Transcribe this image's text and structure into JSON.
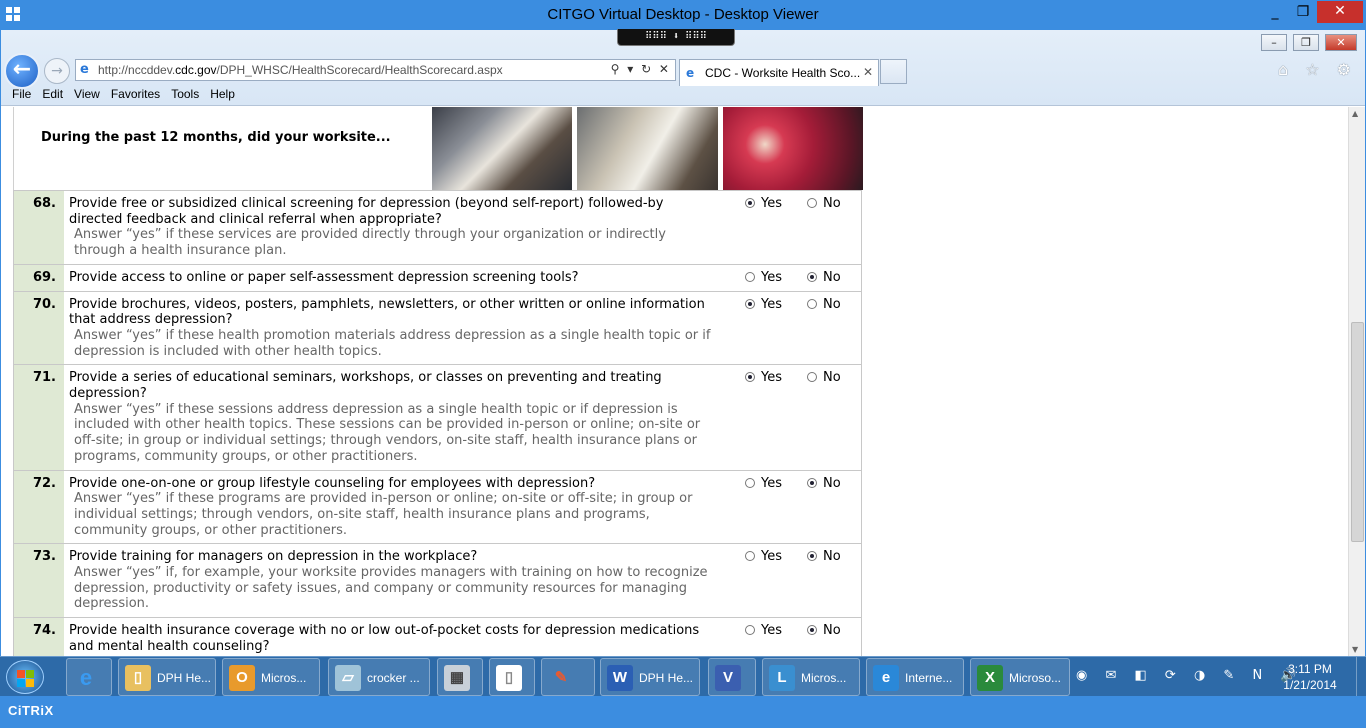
{
  "window": {
    "title": "CITGO Virtual Desktop - Desktop Viewer",
    "minimize": "_",
    "restore": "❐",
    "close": "✕"
  },
  "citrix_toolbar": {
    "label": "⠿⠿⠿ ⬇ ⠿⠿⠿"
  },
  "browser": {
    "url_host_prefix": "http://nccddev.",
    "url_host_main": "cdc.gov",
    "url_path": "/DPH_WHSC/HealthScorecard/HealthScorecard.aspx",
    "address_actions": "⚲ ▾ ↻ ✕",
    "tab_title": "CDC - Worksite Health Sco...",
    "tab_close": "✕",
    "toolbar_icons": "⌂ ☆ ⚙",
    "menu": [
      "File",
      "Edit",
      "View",
      "Favorites",
      "Tools",
      "Help"
    ]
  },
  "page": {
    "header_question": "During the past 12 months, did your worksite...",
    "yes_label": "Yes",
    "no_label": "No",
    "questions": [
      {
        "num": "68.",
        "text": "Provide free or subsidized clinical screening for depression (beyond self-report) followed-by directed feedback and clinical referral when appropriate?",
        "note": "Answer “yes” if these services are provided directly through your organization or indirectly through a health insurance plan.",
        "answer": "yes"
      },
      {
        "num": "69.",
        "text": "Provide access to online or paper self-assessment depression screening tools?",
        "note": "",
        "answer": "no"
      },
      {
        "num": "70.",
        "text": "Provide brochures, videos, posters, pamphlets, newsletters, or other written or online information that address depression?",
        "note": "Answer “yes” if these health promotion materials address depression as a single health topic or if depression is included with other health topics.",
        "answer": "yes"
      },
      {
        "num": "71.",
        "text": "Provide a series of educational seminars, workshops, or classes on preventing and treating depression?",
        "note": "Answer “yes” if these sessions address depression as a single health topic or if depression is included with other health topics. These sessions can be provided in-person or online; on-site or off-site; in group or individual settings; through vendors, on-site staff, health insurance plans or programs, community groups, or other practitioners.",
        "answer": "yes"
      },
      {
        "num": "72.",
        "text": "Provide one-on-one or group lifestyle counseling for employees with depression?",
        "note": "Answer “yes” if these programs are provided in-person or online; on-site or off-site; in group or individual settings; through vendors, on-site staff, health insurance plans and programs, community groups, or other practitioners.",
        "answer": "no"
      },
      {
        "num": "73.",
        "text": "Provide training for managers on depression in the workplace?",
        "note": "Answer “yes” if, for example, your worksite provides managers with training on how to recognize depression, productivity or safety issues, and company or community resources for managing depression.",
        "answer": "no"
      },
      {
        "num": "74.",
        "text": "Provide health insurance coverage with no or low out-of-pocket costs for depression medications and mental health counseling?",
        "note": "",
        "answer": "no"
      }
    ]
  },
  "taskbar": {
    "items": [
      {
        "label": "DPH He...",
        "icon": "folder-icon",
        "glyph": "▯",
        "color": "#e8c060"
      },
      {
        "label": "Micros...",
        "icon": "outlook-icon",
        "glyph": "O",
        "color": "#e89a2c"
      },
      {
        "label": "crocker ...",
        "icon": "notepad-icon",
        "glyph": "▱",
        "color": "#9fc3d8"
      },
      {
        "label": "DPH He...",
        "icon": "word-icon",
        "glyph": "W",
        "color": "#2b5fb4"
      },
      {
        "label": "Micros...",
        "icon": "lync-icon",
        "glyph": "L",
        "color": "#3a8fd0"
      },
      {
        "label": "Interne...",
        "icon": "ie-icon",
        "glyph": "e",
        "color": "#2a88d8"
      },
      {
        "label": "Microso...",
        "icon": "excel-icon",
        "glyph": "X",
        "color": "#2a8a3c"
      }
    ],
    "tray_icons": "◉ ✉ ◧ ⟳ ◑ ✎ N 🔊",
    "time": "3:11 PM",
    "date": "1/21/2014"
  },
  "status": {
    "brand": "CiTRiX"
  }
}
